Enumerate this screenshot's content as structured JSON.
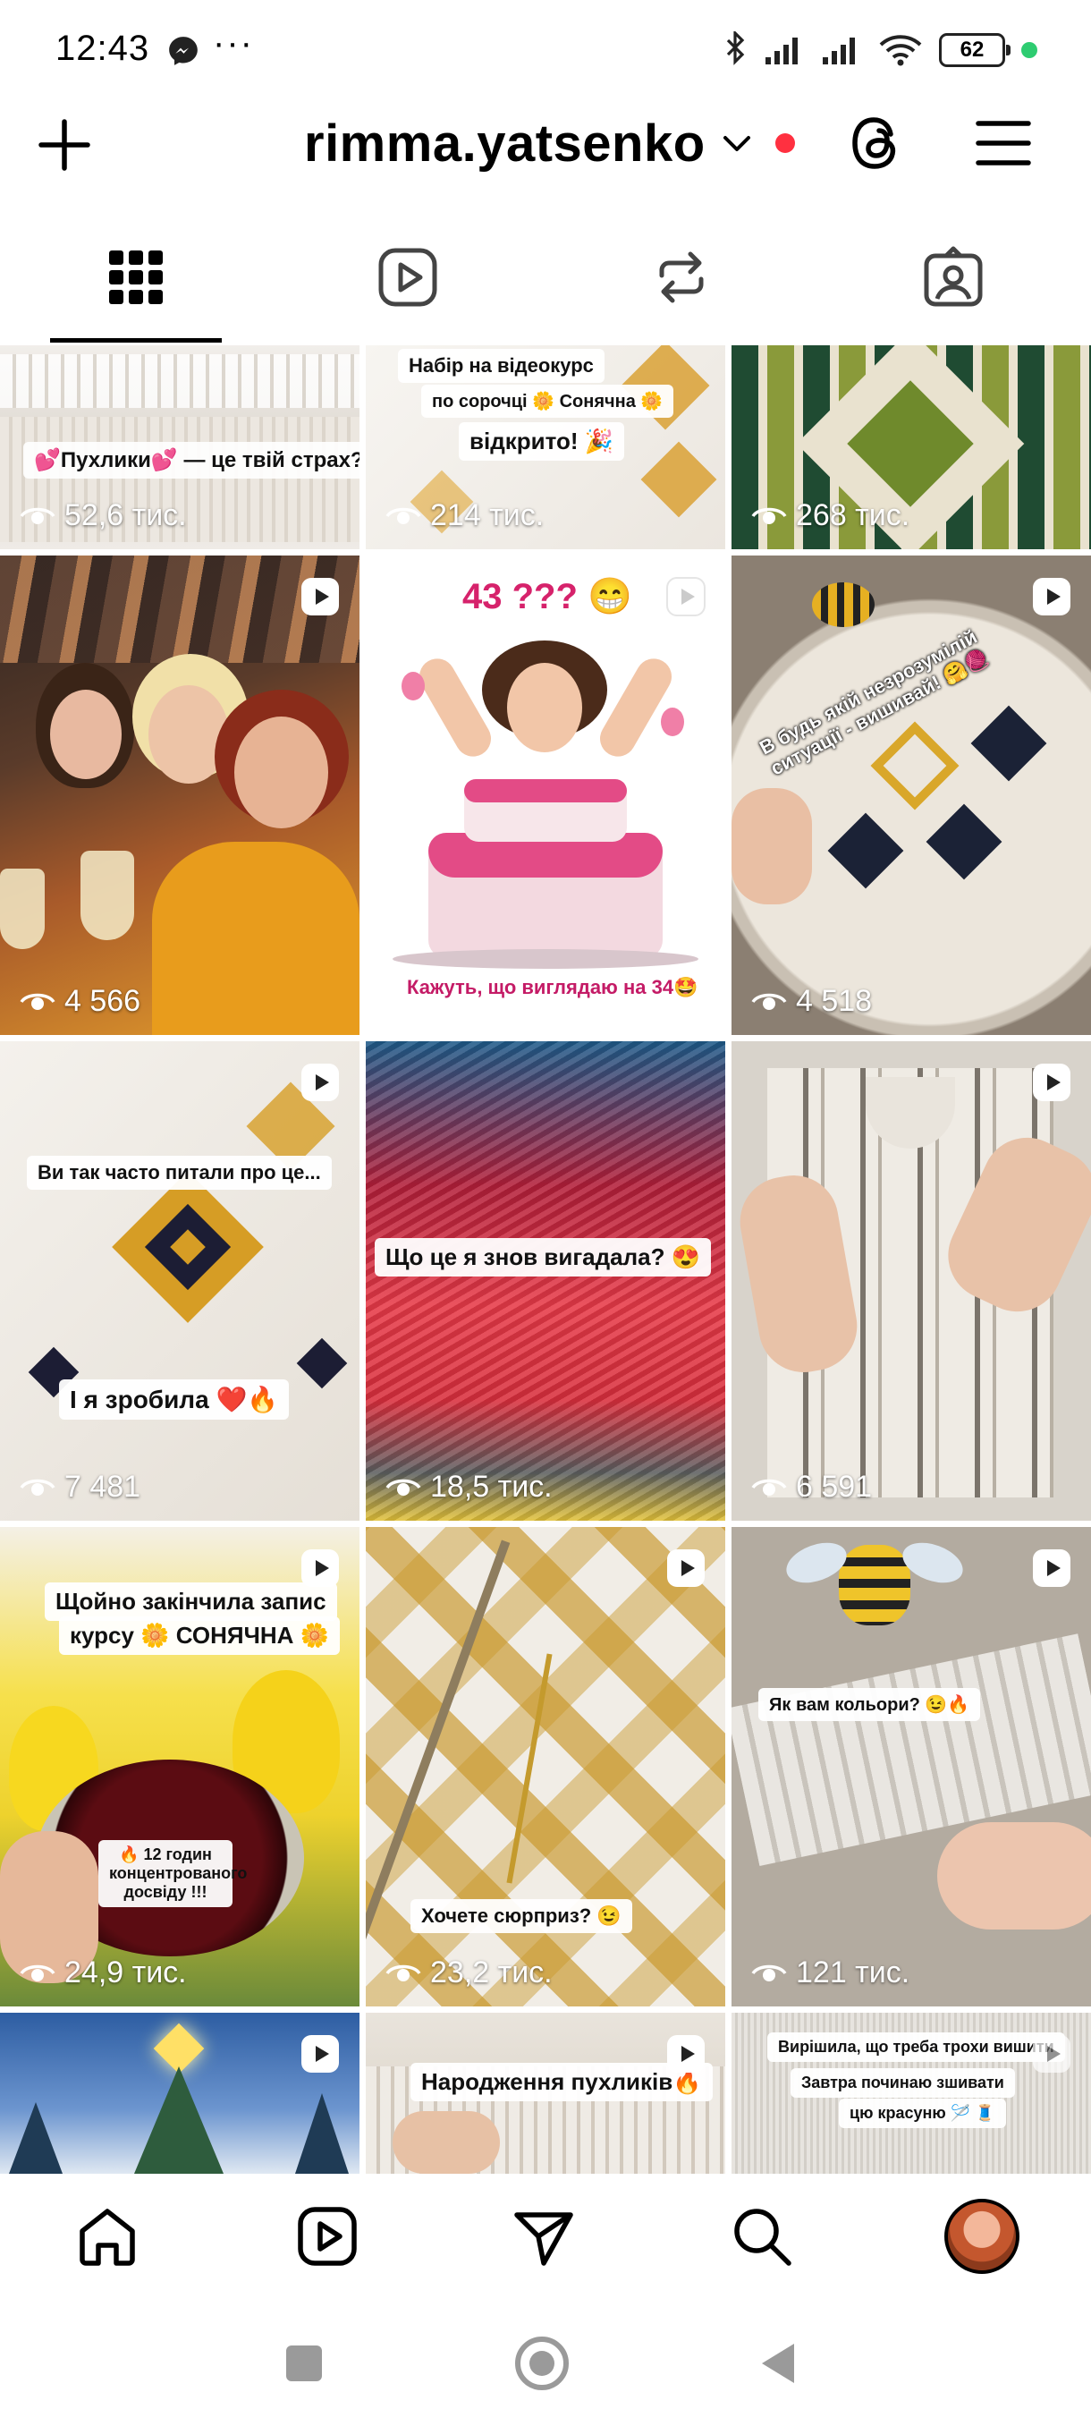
{
  "status_bar": {
    "time": "12:43",
    "more": "···",
    "battery": "62",
    "icons": [
      "messenger-icon",
      "bluetooth-icon",
      "signal-icon",
      "signal-icon",
      "wifi-icon",
      "battery-icon"
    ]
  },
  "header": {
    "username": "rimma.yatsenko",
    "icons": [
      "plus-icon",
      "chevron-down-icon",
      "threads-icon",
      "menu-icon"
    ],
    "notification_dot_color": "#ff3040"
  },
  "tabs": [
    {
      "name": "posts-grid",
      "icon": "grid-icon",
      "active": true
    },
    {
      "name": "reels",
      "icon": "reels-icon",
      "active": false
    },
    {
      "name": "reposts",
      "icon": "repost-icon",
      "active": false
    },
    {
      "name": "tagged",
      "icon": "tagged-icon",
      "active": false
    }
  ],
  "grid": {
    "posts": [
      {
        "views": "52,6 тис.",
        "reel": false,
        "captions": [
          "💕Пухлики💕 — це твій страх?"
        ]
      },
      {
        "views": "214 тис.",
        "reel": false,
        "captions": [
          "Набір на відеокурс",
          "по сорочці 🌼 Сонячна 🌼",
          "відкрито! 🎉"
        ]
      },
      {
        "views": "268 тис.",
        "reel": false,
        "captions": []
      },
      {
        "views": "4 566",
        "reel": true,
        "captions": []
      },
      {
        "views": "",
        "reel": true,
        "captions": [
          "43 ??? 😁",
          "Кажуть, що виглядаю на 34🤩"
        ]
      },
      {
        "views": "4 518",
        "reel": true,
        "captions": [
          "В будь якій незрозумілій ситуації - вишивай! 🤗🧶"
        ]
      },
      {
        "views": "7 481",
        "reel": true,
        "captions": [
          "Ви так часто питали про це...",
          "І я зробила ❤️🔥"
        ]
      },
      {
        "views": "18,5 тис.",
        "reel": false,
        "captions": [
          "Що це я знов вигадала? 😍"
        ]
      },
      {
        "views": "6 591",
        "reel": true,
        "captions": []
      },
      {
        "views": "24,9 тис.",
        "reel": true,
        "captions": [
          "Щойно закінчила запис",
          "курсу 🌼 СОНЯЧНА 🌼",
          "🔥 12 годин концентрованого досвіду !!!"
        ]
      },
      {
        "views": "23,2 тис.",
        "reel": true,
        "captions": [
          "Хочете сюрприз? 😉"
        ]
      },
      {
        "views": "121 тис.",
        "reel": true,
        "captions": [
          "Як вам кольори? 😉🔥"
        ]
      },
      {
        "views": "",
        "reel": true,
        "captions": []
      },
      {
        "views": "",
        "reel": true,
        "captions": [
          "Народження пухликів🔥"
        ]
      },
      {
        "views": "",
        "reel": true,
        "captions": [
          "Вирішила, що треба трохи вишити",
          "Завтра починаю зшивати",
          "цю красуню 🪡 🧵"
        ]
      }
    ]
  },
  "bottom_nav": {
    "icons": [
      "home-icon",
      "reels-icon",
      "send-icon",
      "search-icon",
      "profile-avatar"
    ]
  },
  "system_nav": {
    "icons": [
      "recents-icon",
      "home-circle-icon",
      "back-icon"
    ]
  }
}
